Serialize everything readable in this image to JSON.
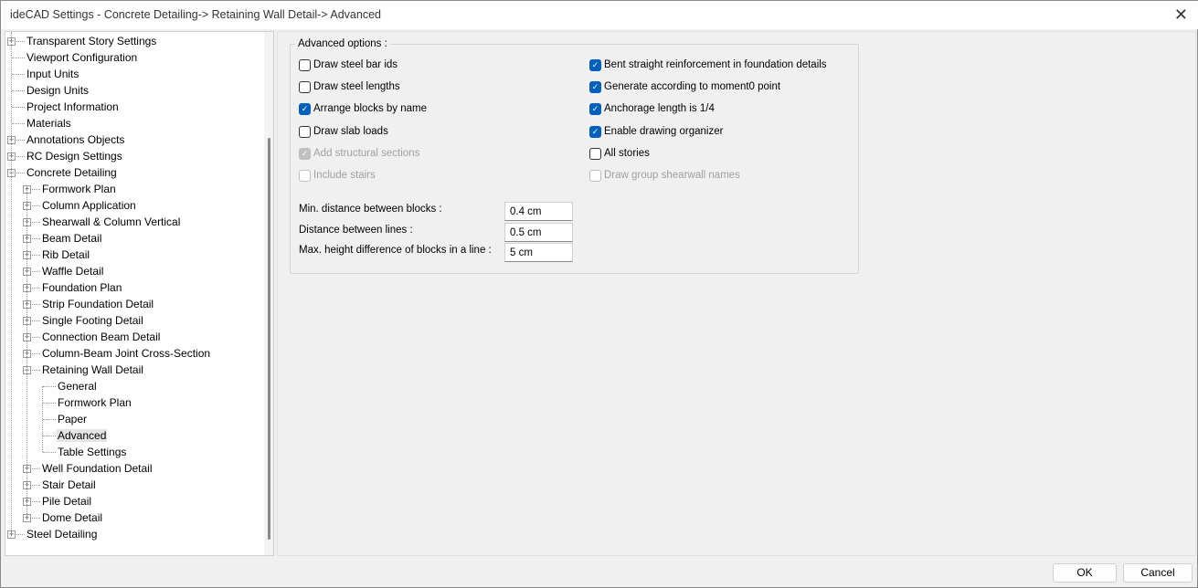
{
  "window": {
    "title": "ideCAD Settings - Concrete Detailing-> Retaining Wall Detail-> Advanced",
    "close": "✕"
  },
  "tree": [
    {
      "label": "Transparent Story Settings",
      "level": 0,
      "exp": "+"
    },
    {
      "label": "Viewport Configuration",
      "level": 0
    },
    {
      "label": "Input Units",
      "level": 0
    },
    {
      "label": "Design Units",
      "level": 0
    },
    {
      "label": "Project Information",
      "level": 0
    },
    {
      "label": "Materials",
      "level": 0
    },
    {
      "label": "Annotations Objects",
      "level": 0,
      "exp": "+"
    },
    {
      "label": "RC Design Settings",
      "level": 0,
      "exp": "+"
    },
    {
      "label": "Concrete Detailing",
      "level": 0,
      "exp": "-"
    },
    {
      "label": "Formwork Plan",
      "level": 1,
      "exp": "+"
    },
    {
      "label": "Column Application",
      "level": 1,
      "exp": "+"
    },
    {
      "label": "Shearwall & Column Vertical",
      "level": 1,
      "exp": "+"
    },
    {
      "label": "Beam Detail",
      "level": 1,
      "exp": "+"
    },
    {
      "label": "Rib Detail",
      "level": 1,
      "exp": "+"
    },
    {
      "label": "Waffle Detail",
      "level": 1,
      "exp": "+"
    },
    {
      "label": "Foundation Plan",
      "level": 1,
      "exp": "+"
    },
    {
      "label": "Strip Foundation Detail",
      "level": 1,
      "exp": "+"
    },
    {
      "label": "Single Footing Detail",
      "level": 1,
      "exp": "+"
    },
    {
      "label": "Connection Beam Detail",
      "level": 1,
      "exp": "+"
    },
    {
      "label": "Column-Beam Joint Cross-Section",
      "level": 1,
      "exp": "+"
    },
    {
      "label": "Retaining Wall Detail",
      "level": 1,
      "exp": "-"
    },
    {
      "label": "General",
      "level": 2
    },
    {
      "label": "Formwork Plan",
      "level": 2
    },
    {
      "label": "Paper",
      "level": 2
    },
    {
      "label": "Advanced",
      "level": 2,
      "selected": true
    },
    {
      "label": "Table Settings",
      "level": 2
    },
    {
      "label": "Well Foundation Detail",
      "level": 1,
      "exp": "+"
    },
    {
      "label": "Stair Detail",
      "level": 1,
      "exp": "+"
    },
    {
      "label": "Pile Detail",
      "level": 1,
      "exp": "+"
    },
    {
      "label": "Dome Detail",
      "level": 1,
      "exp": "+"
    },
    {
      "label": "Steel Detailing",
      "level": 0,
      "exp": "+"
    }
  ],
  "advanced": {
    "group_label": "Advanced options :",
    "left": [
      {
        "label": "Draw steel bar ids",
        "checked": false,
        "enabled": true
      },
      {
        "label": "Draw steel lengths",
        "checked": false,
        "enabled": true
      },
      {
        "label": "Arrange blocks by name",
        "checked": true,
        "enabled": true
      },
      {
        "label": "Draw slab loads",
        "checked": false,
        "enabled": true
      },
      {
        "label": "Add structural sections",
        "checked": true,
        "enabled": false
      },
      {
        "label": "Include stairs",
        "checked": false,
        "enabled": false
      }
    ],
    "right": [
      {
        "label": "Bent straight reinforcement in foundation details",
        "checked": true,
        "enabled": true
      },
      {
        "label": "Generate according to moment0 point",
        "checked": true,
        "enabled": true
      },
      {
        "label": "Anchorage length is 1/4",
        "checked": true,
        "enabled": true
      },
      {
        "label": "Enable drawing organizer",
        "checked": true,
        "enabled": true
      },
      {
        "label": "All stories",
        "checked": false,
        "enabled": true
      },
      {
        "label": "Draw group shearwall names",
        "checked": false,
        "enabled": false
      }
    ],
    "fields": [
      {
        "label": "Min. distance between blocks :",
        "value": "0.4 cm"
      },
      {
        "label": "Distance between lines :",
        "value": "0.5 cm"
      },
      {
        "label": "Max. height difference of blocks in a line :",
        "value": "5 cm"
      }
    ]
  },
  "buttons": {
    "ok": "OK",
    "cancel": "Cancel"
  }
}
